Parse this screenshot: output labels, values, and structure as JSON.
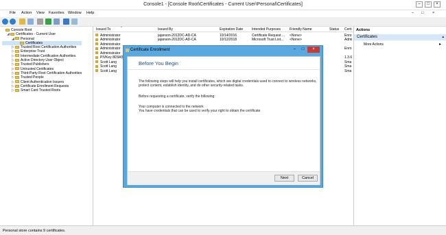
{
  "window": {
    "title": "Console1 - [Console Root\\Certificates - Current User\\Personal\\Certificates]",
    "min_label": "–",
    "max_label": "□",
    "close_label": "×",
    "inner_min_label": "–",
    "inner_max_label": "□",
    "inner_close_label": "×"
  },
  "menu": [
    "File",
    "Action",
    "View",
    "Favorites",
    "Window",
    "Help"
  ],
  "toolbar": {
    "icons": [
      "back-icon",
      "forward-icon",
      "up-icon",
      "show-hide-tree-icon",
      "copy-icon",
      "refresh-icon",
      "export-icon",
      "help-icon",
      "properties-icon"
    ]
  },
  "tree": {
    "items": [
      {
        "label": "Console Root",
        "indent": 0,
        "arrow": ""
      },
      {
        "label": "Certificates - Current User",
        "indent": 1,
        "arrow": "◢"
      },
      {
        "label": "Personal",
        "indent": 2,
        "arrow": "◢"
      },
      {
        "label": "Certificates",
        "indent": 3,
        "arrow": "",
        "selected": true
      },
      {
        "label": "Trusted Root Certification Authorities",
        "indent": 2,
        "arrow": "▷"
      },
      {
        "label": "Enterprise Trust",
        "indent": 2,
        "arrow": "▷"
      },
      {
        "label": "Intermediate Certification Authorities",
        "indent": 2,
        "arrow": "▷"
      },
      {
        "label": "Active Directory User Object",
        "indent": 2,
        "arrow": "▷"
      },
      {
        "label": "Trusted Publishers",
        "indent": 2,
        "arrow": "▷"
      },
      {
        "label": "Untrusted Certificates",
        "indent": 2,
        "arrow": "▷"
      },
      {
        "label": "Third-Party Root Certification Authorities",
        "indent": 2,
        "arrow": "▷"
      },
      {
        "label": "Trusted People",
        "indent": 2,
        "arrow": "▷"
      },
      {
        "label": "Client Authentication Issuers",
        "indent": 2,
        "arrow": "▷"
      },
      {
        "label": "Certificate Enrollment Requests",
        "indent": 2,
        "arrow": "▷"
      },
      {
        "label": "Smart Card Trusted Roots",
        "indent": 2,
        "arrow": "▷"
      }
    ]
  },
  "list": {
    "columns": [
      "Issued To",
      "Issued By",
      "Expiration Date",
      "Intended Purposes",
      "Friendly Name",
      "Status",
      "Certi"
    ],
    "sort_indicator": "^",
    "rows": [
      [
        "Administrator",
        "jajanson-2012DC-AD-CA",
        "10/14/2016",
        "Certificate Request ...",
        "<None>",
        "",
        "Enro"
      ],
      [
        "Administrator",
        "jajanson-2012DC-AD-CA",
        "10/12/2018",
        "Microsoft Trust List...",
        "<None>",
        "",
        "Admi"
      ],
      [
        "Administrator",
        "",
        "",
        "",
        "",
        "",
        ""
      ],
      [
        "Administrator",
        "",
        "",
        "",
        "",
        "",
        "Enro"
      ],
      [
        "Administrator",
        "",
        "",
        "",
        "",
        "",
        ""
      ],
      [
        "PIVKey 8D9A5",
        "",
        "",
        "",
        "",
        "",
        "1.3.6"
      ],
      [
        "Scott Lang",
        "",
        "",
        "",
        "",
        "",
        "Sma"
      ],
      [
        "Scott Lang",
        "",
        "",
        "",
        "",
        "",
        "Sma"
      ],
      [
        "Scott Lang",
        "",
        "",
        "",
        "",
        "",
        "Sma"
      ]
    ]
  },
  "actions": {
    "header": "Actions",
    "section": "Certificates",
    "section_arrow": "▴",
    "more": "More Actions",
    "more_arrow": "▸"
  },
  "status": "Personal store contains 9 certificates.",
  "dialog": {
    "title": "Certificate Enrollment",
    "heading": "Before You Begin",
    "para1": "The following steps will help you install certificates, which are digital credentials used to connect to wireless networks, protect content, establish identity, and do other security-related tasks.",
    "para2": "Before requesting a certificate, verify the following:",
    "para3": "Your computer is connected to the network",
    "para4": "You have credentials that can be used to verify your right to obtain the certificate",
    "next": "Next",
    "cancel": "Cancel"
  },
  "colors": {
    "dialog_frame": "#5aa8e0",
    "dialog_heading": "#1d4b80",
    "actions_section": "#d6e8f7",
    "close_button": "#c93a36"
  }
}
